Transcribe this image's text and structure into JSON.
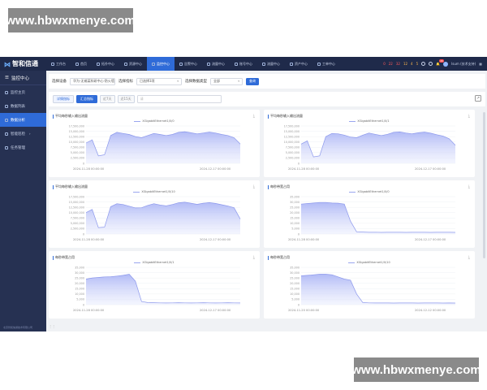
{
  "watermark": "www.hbwxmenye.com",
  "app": {
    "logo": "智和信通",
    "nav": [
      {
        "label": "工作台",
        "icon": "desktop-icon",
        "active": false
      },
      {
        "label": "首页",
        "icon": "home-icon",
        "active": false
      },
      {
        "label": "拓扑中心",
        "icon": "topology-icon",
        "active": false
      },
      {
        "label": "资源中心",
        "icon": "resource-icon",
        "active": false
      },
      {
        "label": "监控中心",
        "icon": "monitor-icon",
        "active": true
      },
      {
        "label": "告警中心",
        "icon": "alarm-icon",
        "active": false
      },
      {
        "label": "流量中心",
        "icon": "traffic-icon",
        "active": false
      },
      {
        "label": "账号中心",
        "icon": "account-icon",
        "active": false
      },
      {
        "label": "流量中心",
        "icon": "flow-icon",
        "active": false
      },
      {
        "label": "资产中心",
        "icon": "asset-icon",
        "active": false
      },
      {
        "label": "工单中心",
        "icon": "ticket-icon",
        "active": false
      }
    ],
    "alarms": [
      "0",
      "22",
      "32",
      "12",
      "4",
      "5"
    ],
    "notif_count": "15",
    "user": "Isum (技术支持)"
  },
  "sidebar": {
    "title": "监控中心",
    "items": [
      {
        "label": "监控主页",
        "icon": "home-icon",
        "active": false
      },
      {
        "label": "数据列表",
        "icon": "list-icon",
        "active": false
      },
      {
        "label": "数据分析",
        "icon": "analysis-icon",
        "active": true
      },
      {
        "label": "智能巡检",
        "icon": "inspect-icon",
        "active": false,
        "has_children": true
      },
      {
        "label": "任务管理",
        "icon": "task-icon",
        "active": false
      }
    ],
    "footer": "北京智和信通技术有限公司"
  },
  "filters": {
    "device_label": "选择设备",
    "device_value": "华为-无锡某科研中心-防火墙",
    "metric_label": "选择指标",
    "metric_value": "已选择3项",
    "type_label": "选择数据类型",
    "type_value": "全部",
    "query": "查询"
  },
  "tabs": [
    {
      "label": "详情指标",
      "active": false
    },
    {
      "label": "汇总指标",
      "active": true
    }
  ],
  "range_tabs": [
    "近7天",
    "近15天"
  ],
  "search_placeholder": "请",
  "charts": [
    {
      "title": "平均每秒输入输出流量",
      "legend": "XGigabitEthernet1/0/0",
      "x_start": "2024-11-28 00:00:00",
      "x_end": "2024-12-17 00:00:00",
      "chart_data": {
        "type": "area",
        "yticks": [
          "17,500,000",
          "15,000,000",
          "12,500,000",
          "10,000,000",
          "7,500,000",
          "5,000,000",
          "2,500,000",
          "0"
        ],
        "ylim": [
          0,
          17500000
        ],
        "values": [
          9500000,
          11000000,
          3500000,
          4000000,
          13000000,
          14500000,
          14000000,
          13500000,
          12500000,
          12000000,
          13000000,
          14000000,
          13500000,
          13000000,
          13500000,
          14500000,
          14800000,
          14300000,
          13800000,
          14200000,
          14600000,
          14200000,
          13500000,
          13000000,
          12000000,
          9000000
        ]
      }
    },
    {
      "title": "平均每秒输入输出流量",
      "legend": "XGigabitEthernet1/0/1",
      "x_start": "2024-11-28 00:00:00",
      "x_end": "2024-12-17 00:00:00",
      "chart_data": {
        "type": "area",
        "yticks": [
          "17,500,000",
          "15,000,000",
          "12,500,000",
          "10,000,000",
          "7,500,000",
          "5,000,000",
          "2,500,000",
          "0"
        ],
        "ylim": [
          0,
          17500000
        ],
        "values": [
          9000000,
          10500000,
          3000000,
          3500000,
          12500000,
          14000000,
          13800000,
          13200000,
          12300000,
          12000000,
          13200000,
          14200000,
          13600000,
          13000000,
          13600000,
          14500000,
          14700000,
          14200000,
          13800000,
          14300000,
          14600000,
          14100000,
          13400000,
          12800000,
          11500000,
          8500000
        ]
      }
    },
    {
      "title": "平均每秒输入输出流量",
      "legend": "XGigabitEthernet1/0/10",
      "x_start": "2024-11-28 00:00:00",
      "x_end": "2024-12-17 00:00:00",
      "chart_data": {
        "type": "area",
        "yticks": [
          "17,500,000",
          "15,000,000",
          "12,500,000",
          "10,000,000",
          "7,500,000",
          "5,000,000",
          "2,500,000",
          "0"
        ],
        "ylim": [
          0,
          17500000
        ],
        "values": [
          10000000,
          11500000,
          3000000,
          3200000,
          12800000,
          14200000,
          13800000,
          13000000,
          12200000,
          12300000,
          13400000,
          14200000,
          13600000,
          13200000,
          13800000,
          14600000,
          14900000,
          14400000,
          13900000,
          14400000,
          14700000,
          14300000,
          13700000,
          13100000,
          12300000,
          7000000
        ]
      }
    },
    {
      "title": "每秒带宽占用",
      "legend": "XGigabitEthernet1/0/0",
      "x_start": "2024-11-28 00:00:00",
      "x_end": "2024-12-17 00:00:00",
      "chart_data": {
        "type": "area",
        "yticks": [
          "35,000",
          "30,000",
          "25,000",
          "20,000",
          "15,000",
          "10,000",
          "5,000",
          "0"
        ],
        "ylim": [
          0,
          35000
        ],
        "values": [
          28000,
          28500,
          29000,
          29500,
          29500,
          29000,
          28800,
          28000,
          12000,
          2000,
          1800,
          1600,
          1700,
          1500,
          1600,
          1700,
          1600,
          1500,
          1600,
          1700,
          1600,
          1500,
          1600,
          1700,
          1600,
          1500
        ]
      }
    },
    {
      "title": "每秒带宽占用",
      "legend": "XGigabitEthernet1/0/1",
      "x_start": "2024-11-28 00:00:00",
      "x_end": "2024-12-17 00:00:00",
      "chart_data": {
        "type": "area",
        "yticks": [
          "35,000",
          "30,000",
          "25,000",
          "20,000",
          "15,000",
          "10,000",
          "5,000",
          "0"
        ],
        "ylim": [
          0,
          35000
        ],
        "values": [
          24000,
          25000,
          25500,
          26000,
          26200,
          26800,
          27500,
          28500,
          22000,
          3000,
          2000,
          1800,
          1700,
          1600,
          1700,
          1800,
          1700,
          1600,
          1700,
          1800,
          1700,
          1600,
          1700,
          1800,
          1700,
          1600
        ]
      }
    },
    {
      "title": "每秒带宽占用",
      "legend": "XGigabitEthernet1/0/10",
      "x_start": "2024-11-20 00:00:00",
      "x_end": "2024-12-12 00:00:00",
      "chart_data": {
        "type": "area",
        "yticks": [
          "35,000",
          "30,000",
          "25,000",
          "20,000",
          "15,000",
          "10,000",
          "5,000",
          "0"
        ],
        "ylim": [
          0,
          35000
        ],
        "values": [
          27000,
          27500,
          28000,
          28500,
          28500,
          28000,
          26000,
          24000,
          23000,
          10000,
          2000,
          1700,
          1600,
          1700,
          1600,
          1500,
          1600,
          1700,
          1600,
          1500,
          1600,
          1700,
          1600,
          1500,
          1600,
          1500
        ]
      }
    }
  ]
}
